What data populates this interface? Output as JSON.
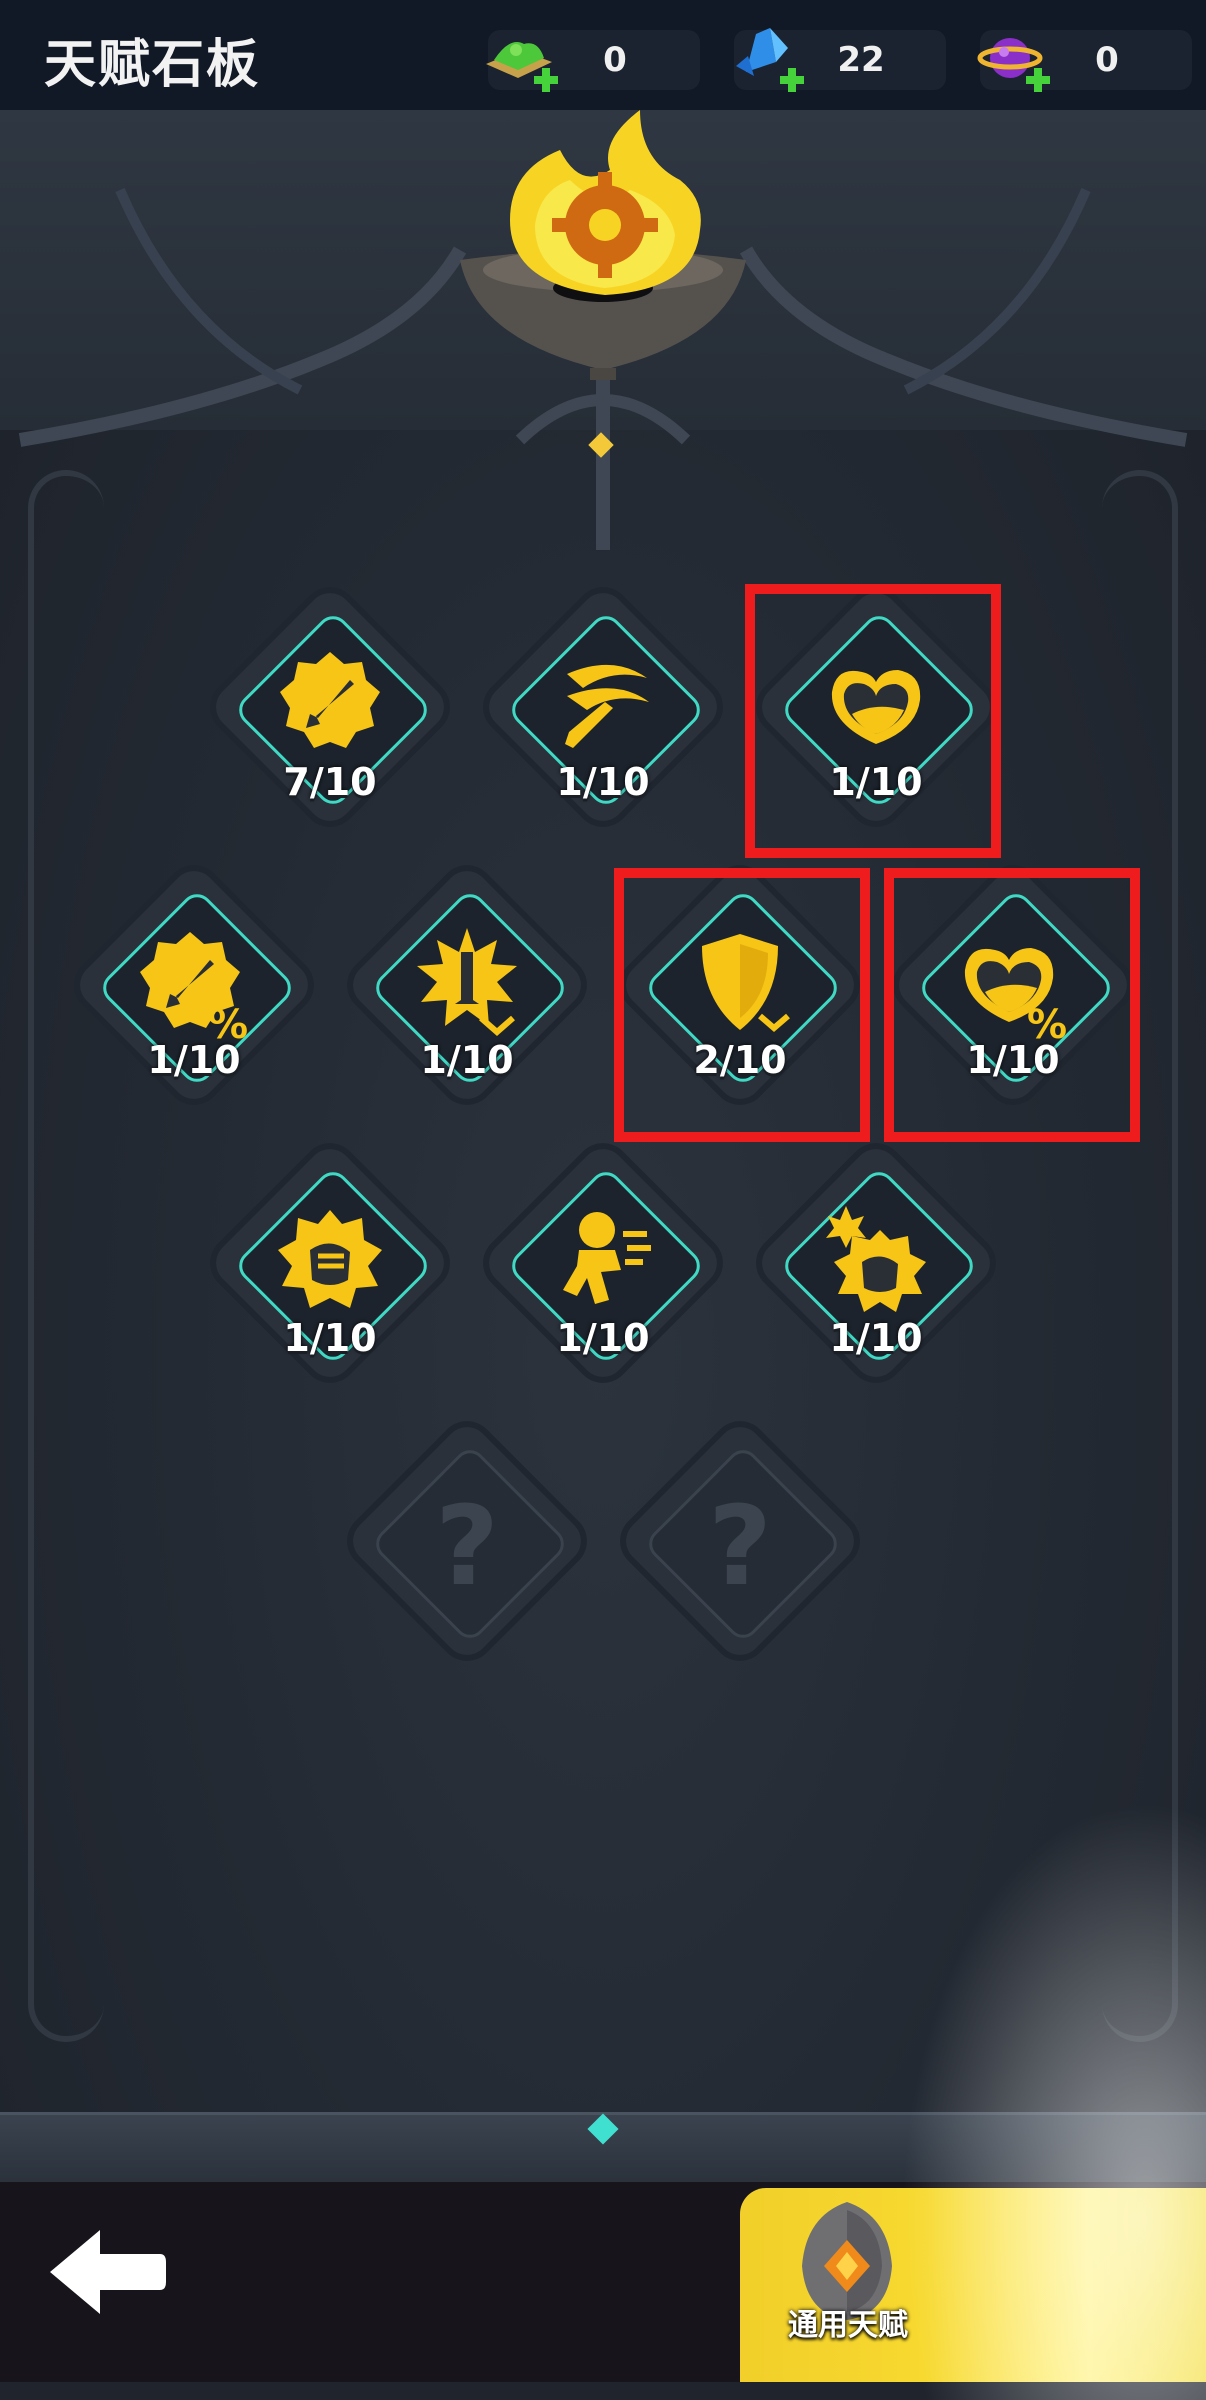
{
  "header": {
    "title": "天赋石板",
    "currencies": [
      {
        "name": "green-gem-icon",
        "value": "0"
      },
      {
        "name": "blue-crystal-icon",
        "value": "22"
      },
      {
        "name": "purple-orb-icon",
        "value": "0"
      }
    ]
  },
  "talents": [
    {
      "icon": "sword-badge-icon",
      "level": "7/10",
      "highlighted": false
    },
    {
      "icon": "slash-icon",
      "level": "1/10",
      "highlighted": false
    },
    {
      "icon": "heart-icon",
      "level": "1/10",
      "highlighted": true
    },
    {
      "icon": "sword-badge-percent-icon",
      "level": "1/10",
      "highlighted": false
    },
    {
      "icon": "burst-sword-icon",
      "level": "1/10",
      "highlighted": false
    },
    {
      "icon": "shield-icon",
      "level": "2/10",
      "highlighted": true
    },
    {
      "icon": "heart-percent-icon",
      "level": "1/10",
      "highlighted": true
    },
    {
      "icon": "fist-icon",
      "level": "1/10",
      "highlighted": false
    },
    {
      "icon": "runner-icon",
      "level": "1/10",
      "highlighted": false
    },
    {
      "icon": "fist-burst-icon",
      "level": "1/10",
      "highlighted": false
    },
    {
      "icon": "locked-question-icon",
      "level": "?",
      "locked": true
    },
    {
      "icon": "locked-question-icon",
      "level": "?",
      "locked": true
    }
  ],
  "footer": {
    "back_icon": "back-arrow-icon",
    "general_talent_label": "通用天赋"
  },
  "colors": {
    "accent_teal": "#3fd9c4",
    "icon_gold": "#f6c516",
    "highlight_red": "#ee1c1c",
    "button_yellow": "#f7d92f"
  }
}
